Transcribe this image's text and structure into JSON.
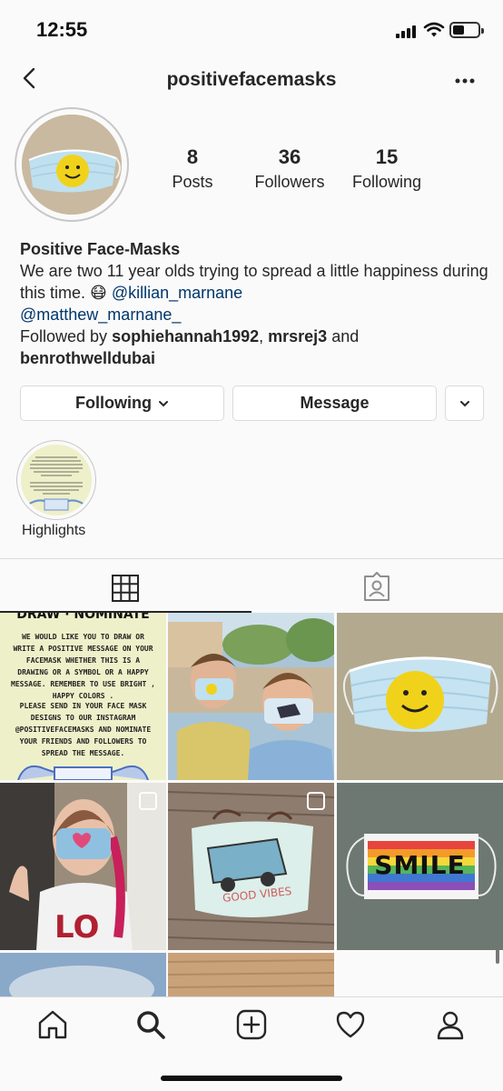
{
  "status_bar": {
    "time": "12:55"
  },
  "header": {
    "username": "positivefacemasks"
  },
  "profile": {
    "stats": [
      {
        "num": "8",
        "label": "Posts"
      },
      {
        "num": "36",
        "label": "Followers"
      },
      {
        "num": "15",
        "label": "Following"
      }
    ],
    "display_name": "Positive Face-Masks",
    "bio_text": "We are two 11 year olds trying to spread a little happiness during this time. 😷",
    "mention_1": "@killian_marnane",
    "mention_2": "@matthew_marnane_",
    "followed_by_prefix": "Followed by ",
    "follower_1": "sophiehannah1992",
    "separator": ", ",
    "follower_2": "mrsrej3",
    "and_text": " and",
    "follower_3": "benrothwelldubai"
  },
  "actions": {
    "following_label": "Following",
    "message_label": "Message"
  },
  "highlights": [
    {
      "label": "Highlights"
    }
  ],
  "grid": {
    "post1_heading": "DRAW · NOMINATE",
    "post1_text_a": "WE WOULD LIKE YOU TO DRAW OR WRITE A POSITIVE MESSAGE ON YOUR FACEMASK WHETHER THIS IS A DRAWING OR A SYMBOL OR A HAPPY MESSAGE. REMEMBER TO USE BRIGHT , HAPPY COLORS .",
    "post1_text_b": "PLEASE SEND IN YOUR FACE MASK DESIGNS TO OUR INSTAGRAM @POSITIVEFACEMASKS AND NOMINATE YOUR FRIENDS AND FOLLOWERS TO SPREAD THE MESSAGE.",
    "post5_text": "GOOD VIBES",
    "post6_text": "SMILE"
  },
  "icons": {
    "back": "chevron-left-icon",
    "more": "more-horizontal-icon",
    "dropdown": "chevron-down-icon",
    "grid": "grid-icon",
    "tagged": "tagged-icon",
    "home": "home-icon",
    "search": "search-icon",
    "add": "add-post-icon",
    "activity": "heart-icon",
    "profile": "profile-icon"
  },
  "colors": {
    "mention": "#00376b",
    "border": "#dbdbdb",
    "text": "#262626",
    "background": "#fafafa"
  }
}
